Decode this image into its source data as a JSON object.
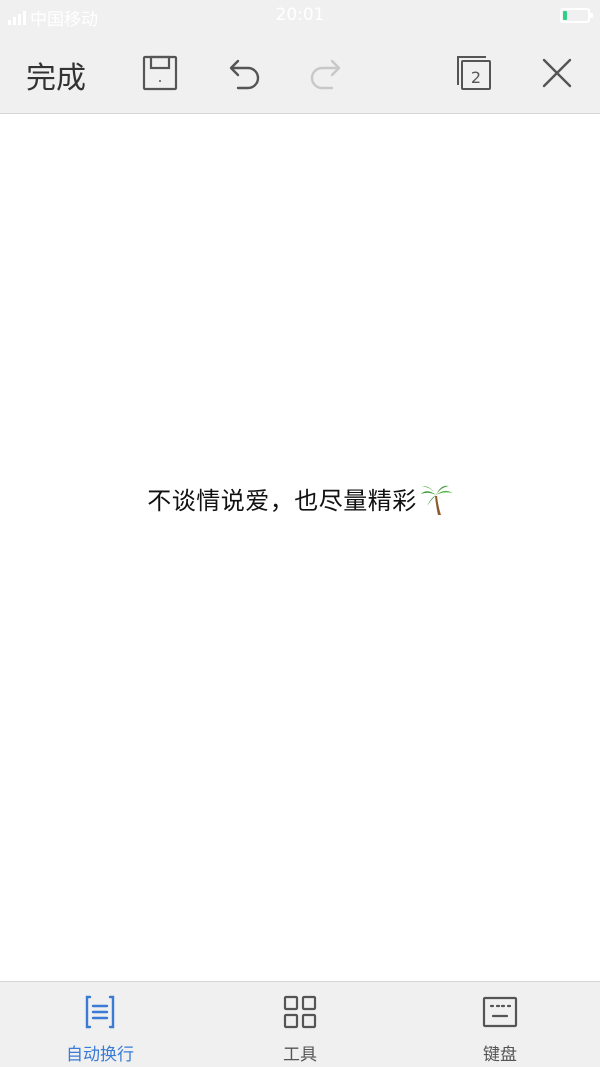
{
  "status_bar": {
    "carrier": "中国移动",
    "time": "20:01",
    "battery_level": 0.15,
    "battery_color": "#2fd08a"
  },
  "toolbar": {
    "done_label": "完成",
    "save_icon": "save-icon",
    "undo_icon": "undo-icon",
    "redo_icon": "redo-icon",
    "windows_count": "2",
    "close_icon": "close-icon"
  },
  "document": {
    "text": "不谈情说爱，也尽量精彩",
    "trailing_icon": "palm-tree-icon"
  },
  "bottom_bar": {
    "accent_color": "#3a7bd5",
    "items": [
      {
        "label": "自动换行",
        "icon": "wrap-text-icon",
        "active": true
      },
      {
        "label": "工具",
        "icon": "grid-icon",
        "active": false
      },
      {
        "label": "键盘",
        "icon": "keyboard-icon",
        "active": false
      }
    ]
  }
}
